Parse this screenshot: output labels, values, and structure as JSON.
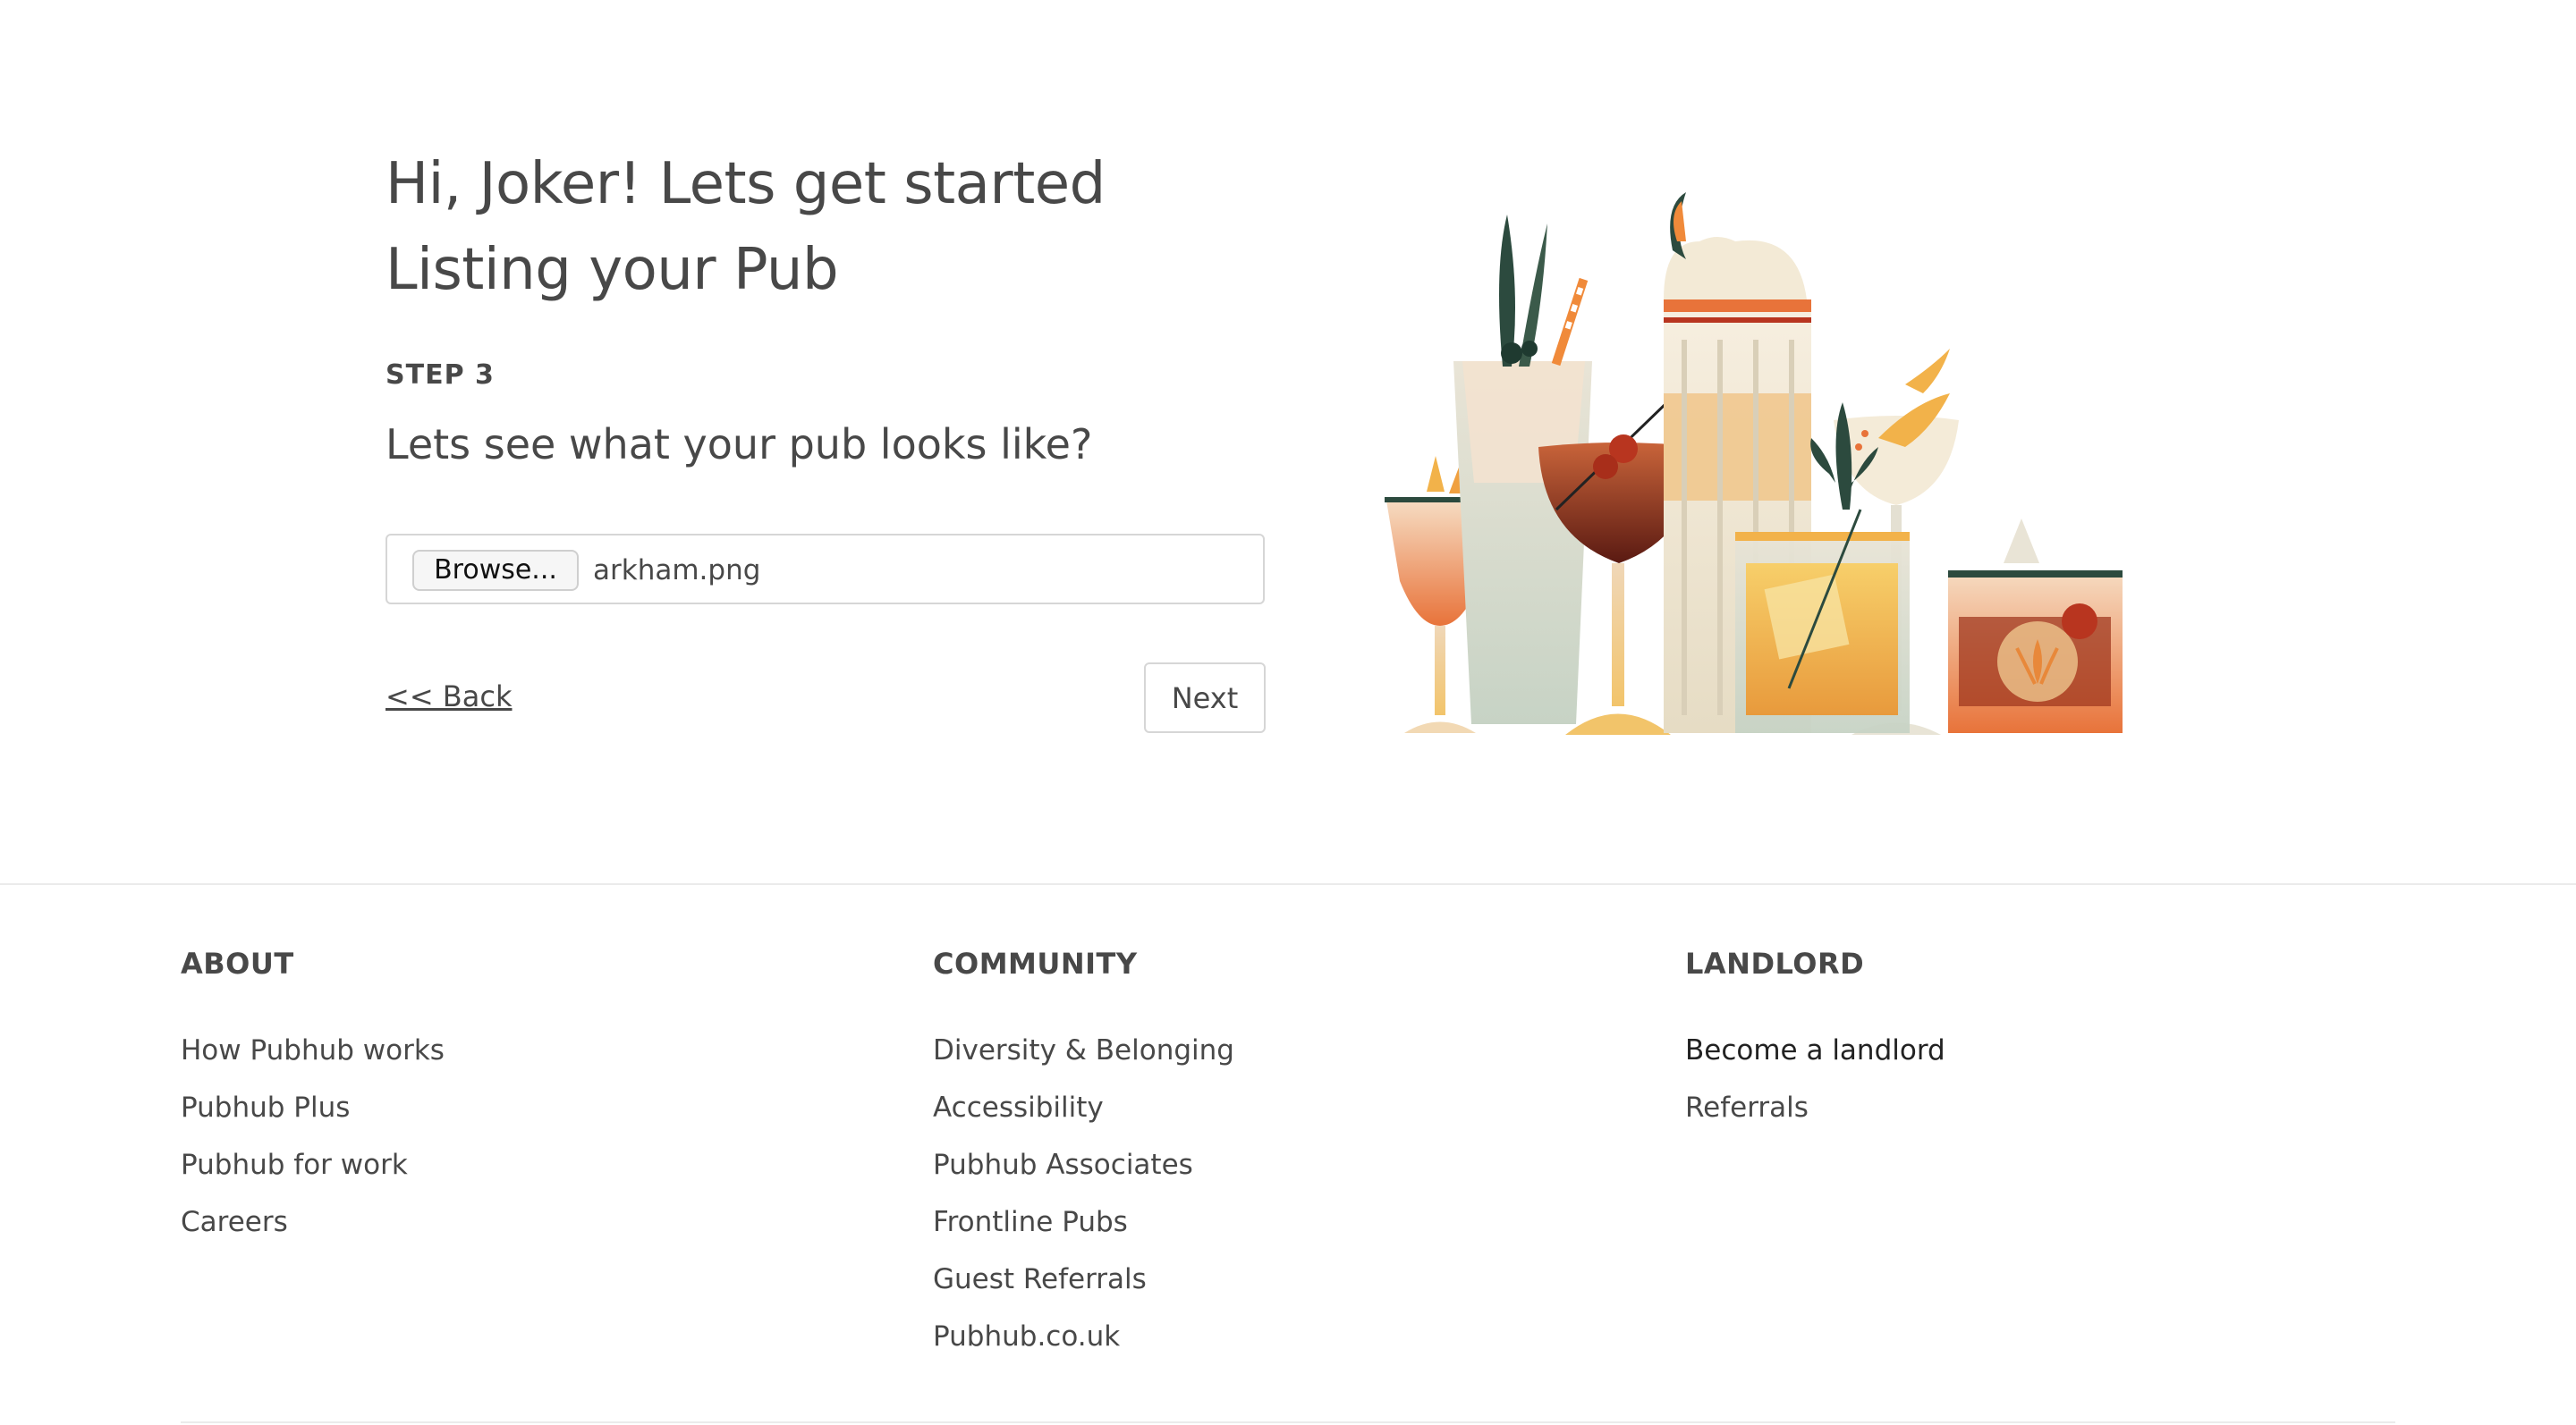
{
  "onboarding": {
    "heading": "Hi, Joker! Lets get started Listing your Pub",
    "step_label": "STEP 3",
    "question": "Lets see what your pub looks like?",
    "file_input": {
      "browse_label": "Browse...",
      "file_name": "arkham.png"
    },
    "back_label": "<< Back",
    "next_label": "Next"
  },
  "illustration": {
    "icon": "cocktail-drinks-illustration",
    "colors": {
      "orange": "#e8883a",
      "amber": "#f2b24a",
      "burgundy": "#7a2418",
      "red": "#b8351f",
      "cream": "#f3ead6",
      "sage": "#cfd9cc",
      "dark_green": "#2c4a3e"
    }
  },
  "footer": {
    "columns": [
      {
        "title": "ABOUT",
        "links": [
          "How Pubhub works",
          "Pubhub Plus",
          "Pubhub for work",
          "Careers"
        ]
      },
      {
        "title": "COMMUNITY",
        "links": [
          "Diversity & Belonging",
          "Accessibility",
          "Pubhub Associates",
          "Frontline Pubs",
          "Guest Referrals",
          "Pubhub.co.uk"
        ]
      },
      {
        "title": "LANDLORD",
        "links": [
          "Become a landlord",
          "Referrals"
        ]
      }
    ]
  }
}
